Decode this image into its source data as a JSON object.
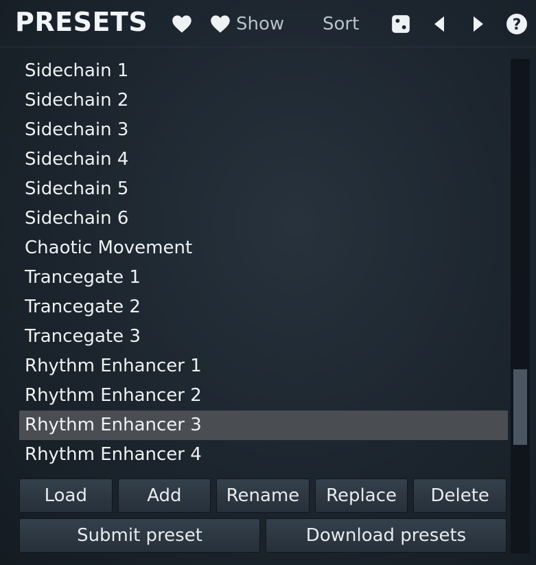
{
  "header": {
    "title": "PRESETS",
    "show_label": "Show",
    "sort_label": "Sort"
  },
  "presets": [
    "Sidechain 1",
    "Sidechain 2",
    "Sidechain 3",
    "Sidechain 4",
    "Sidechain 5",
    "Sidechain 6",
    "Chaotic Movement",
    "Trancegate 1",
    "Trancegate 2",
    "Trancegate 3",
    "Rhythm Enhancer 1",
    "Rhythm Enhancer 2",
    "Rhythm Enhancer 3",
    "Rhythm Enhancer 4"
  ],
  "selected_preset": "Rhythm Enhancer 3",
  "buttons": {
    "load": "Load",
    "add": "Add",
    "rename": "Rename",
    "replace": "Replace",
    "delete": "Delete",
    "submit": "Submit preset",
    "download": "Download presets"
  },
  "icons": {
    "favorite": "heart-icon",
    "show_favorites": "heart-icon",
    "random": "dice-icon",
    "previous": "triangle-left-icon",
    "next": "triangle-right-icon",
    "help": "question-circle-icon"
  },
  "colors": {
    "background": "#1c252e",
    "selected_row": "#4a4e52",
    "text": "#eef2f4",
    "scroll_thumb": "#4a5762"
  }
}
